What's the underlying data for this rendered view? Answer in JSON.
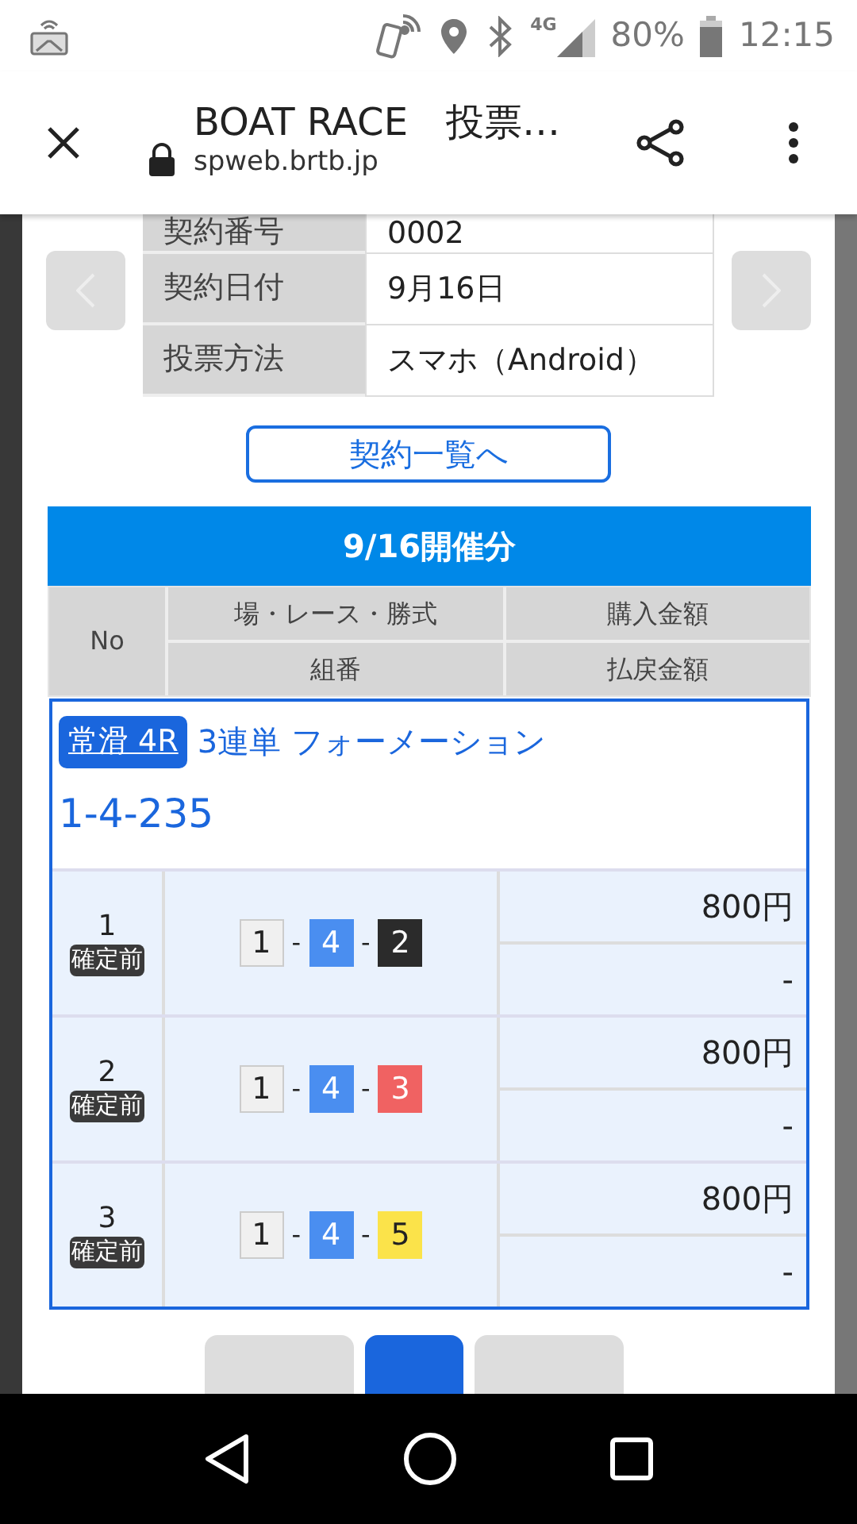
{
  "status_bar": {
    "network": "4G",
    "battery_text": "80%",
    "time": "12:15"
  },
  "browser": {
    "title": "BOAT RACE　投票…",
    "url": "spweb.brtb.jp"
  },
  "contract_info": [
    {
      "label": "契約番号",
      "value": "0002"
    },
    {
      "label": "契約日付",
      "value": "9月16日"
    },
    {
      "label": "投票方法",
      "value": "スマホ（Android）"
    }
  ],
  "contract_list_button": "契約一覧へ",
  "section_title": "9/16開催分",
  "table": {
    "columns": {
      "no": "No",
      "race": "場・レース・勝式",
      "combination": "組番",
      "purchase": "購入金額",
      "payout": "払戻金額"
    },
    "bet": {
      "venue_race": "常滑 4R",
      "bet_type": "3連単 フォーメーション",
      "selection": "1-4-235"
    },
    "separator": "-",
    "rows": [
      {
        "no": "1",
        "status": "確定前",
        "boats": [
          {
            "number": "1",
            "color": "#f0f0f0"
          },
          {
            "number": "4",
            "color": "#4a8ef0"
          },
          {
            "number": "2",
            "color": "#2b2b2b"
          }
        ],
        "purchase": "800円",
        "payout": "-"
      },
      {
        "no": "2",
        "status": "確定前",
        "boats": [
          {
            "number": "1",
            "color": "#f0f0f0"
          },
          {
            "number": "4",
            "color": "#4a8ef0"
          },
          {
            "number": "3",
            "color": "#f06262"
          }
        ],
        "purchase": "800円",
        "payout": "-"
      },
      {
        "no": "3",
        "status": "確定前",
        "boats": [
          {
            "number": "1",
            "color": "#f0f0f0"
          },
          {
            "number": "4",
            "color": "#4a8ef0"
          },
          {
            "number": "5",
            "color": "#fbe34a"
          }
        ],
        "purchase": "800円",
        "payout": "-"
      }
    ]
  },
  "pagination": [
    {
      "selected": false
    },
    {
      "selected": true
    },
    {
      "selected": false
    }
  ]
}
